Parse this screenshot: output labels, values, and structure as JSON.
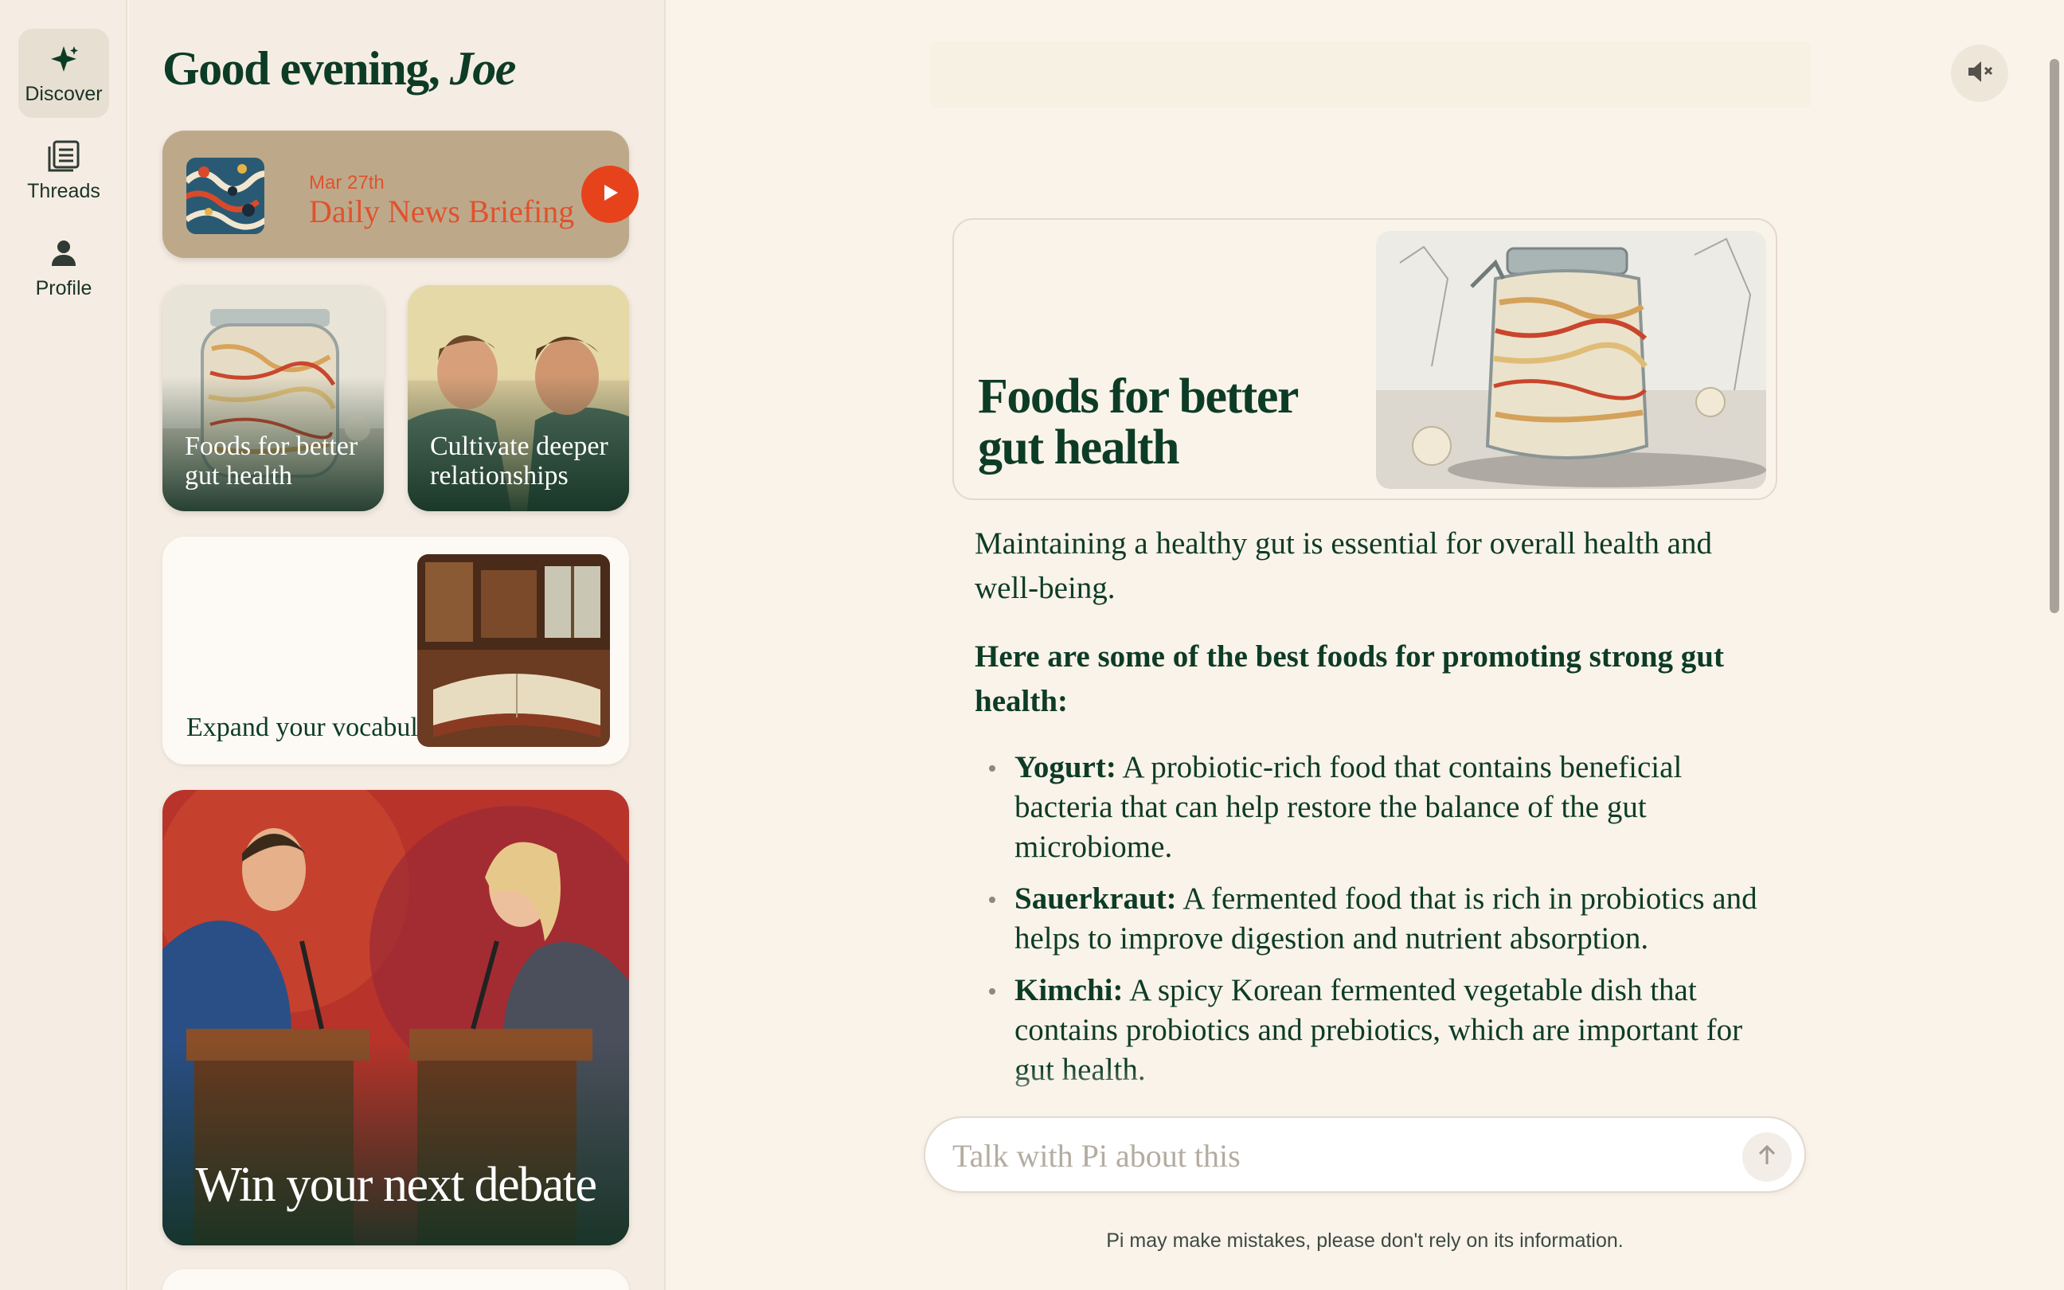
{
  "nav": {
    "items": [
      {
        "label": "Discover",
        "icon": "sparkle-icon",
        "active": true
      },
      {
        "label": "Threads",
        "icon": "threads-icon",
        "active": false
      },
      {
        "label": "Profile",
        "icon": "person-icon",
        "active": false
      }
    ]
  },
  "discover": {
    "greeting_prefix": "Good evening,",
    "greeting_name": "Joe",
    "news": {
      "date": "Mar 27th",
      "title": "Daily News Briefing",
      "play_icon": "play-icon"
    },
    "tiles": [
      {
        "caption": "Foods for better gut health"
      },
      {
        "caption": "Cultivate deeper relationships"
      },
      {
        "caption": "Expand your vocabulary"
      },
      {
        "caption": "Win your next debate"
      }
    ]
  },
  "main": {
    "mute_icon": "speaker-muted-icon",
    "topic_title": "Foods for better gut health",
    "intro": "Maintaining a healthy gut is essential for overall health and well-being.",
    "lead": "Here are some of the best foods for promoting strong gut health:",
    "foods": [
      {
        "name": "Yogurt:",
        "desc": " A probiotic-rich food that contains beneficial bacteria that can help restore the balance of the gut microbiome."
      },
      {
        "name": "Sauerkraut:",
        "desc": " A fermented food that is rich in probiotics and helps to improve digestion and nutrient absorption."
      },
      {
        "name": "Kimchi:",
        "desc": " A spicy Korean fermented vegetable dish that contains probiotics and prebiotics, which are important for gut health."
      }
    ],
    "input_placeholder": "Talk with Pi about this",
    "send_icon": "arrow-up-icon",
    "disclaimer": "Pi may make mistakes, please don't rely on its information."
  },
  "colors": {
    "accent": "#e6431d",
    "text_dark_green": "#0d3c26",
    "background": "#faf3ea",
    "sidebar": "#f5ede3",
    "news_card": "#bda98a"
  }
}
